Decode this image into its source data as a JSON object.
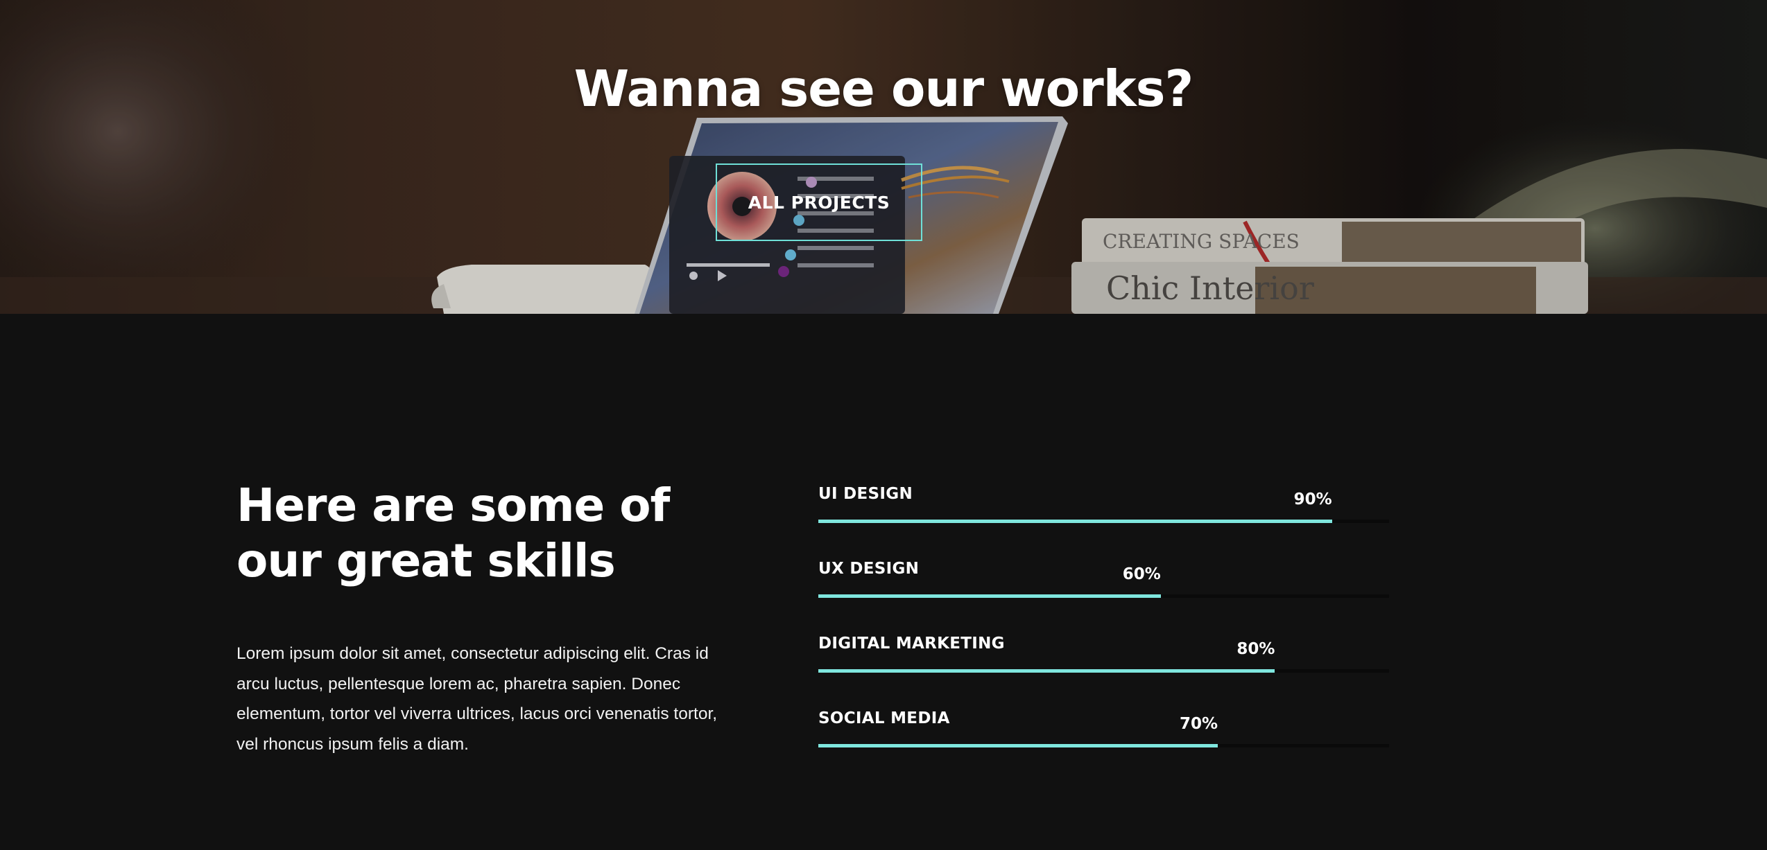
{
  "hero": {
    "title": "Wanna see our works?",
    "button_label": "ALL PROJECTS",
    "background_image": "laptop-desk-scene"
  },
  "skills": {
    "title_line1": "Here are some of",
    "title_line2": "our great skills",
    "description": "Lorem ipsum dolor sit amet, consectetur adipiscing elit. Cras id arcu luctus, pellentesque lorem ac, pharetra sapien. Donec elementum, tortor vel viverra ultrices, lacus orci venenatis tortor, vel rhoncus ipsum felis a diam.",
    "items": [
      {
        "label": "UI DESIGN",
        "value": 90,
        "display": "90%"
      },
      {
        "label": "UX DESIGN",
        "value": 60,
        "display": "60%"
      },
      {
        "label": "DIGITAL MARKETING",
        "value": 80,
        "display": "80%"
      },
      {
        "label": "SOCIAL MEDIA",
        "value": 70,
        "display": "70%"
      }
    ]
  },
  "colors": {
    "background": "#111111",
    "accent": "#7fe6de",
    "track": "#0a0a0a",
    "text": "#ffffff"
  }
}
